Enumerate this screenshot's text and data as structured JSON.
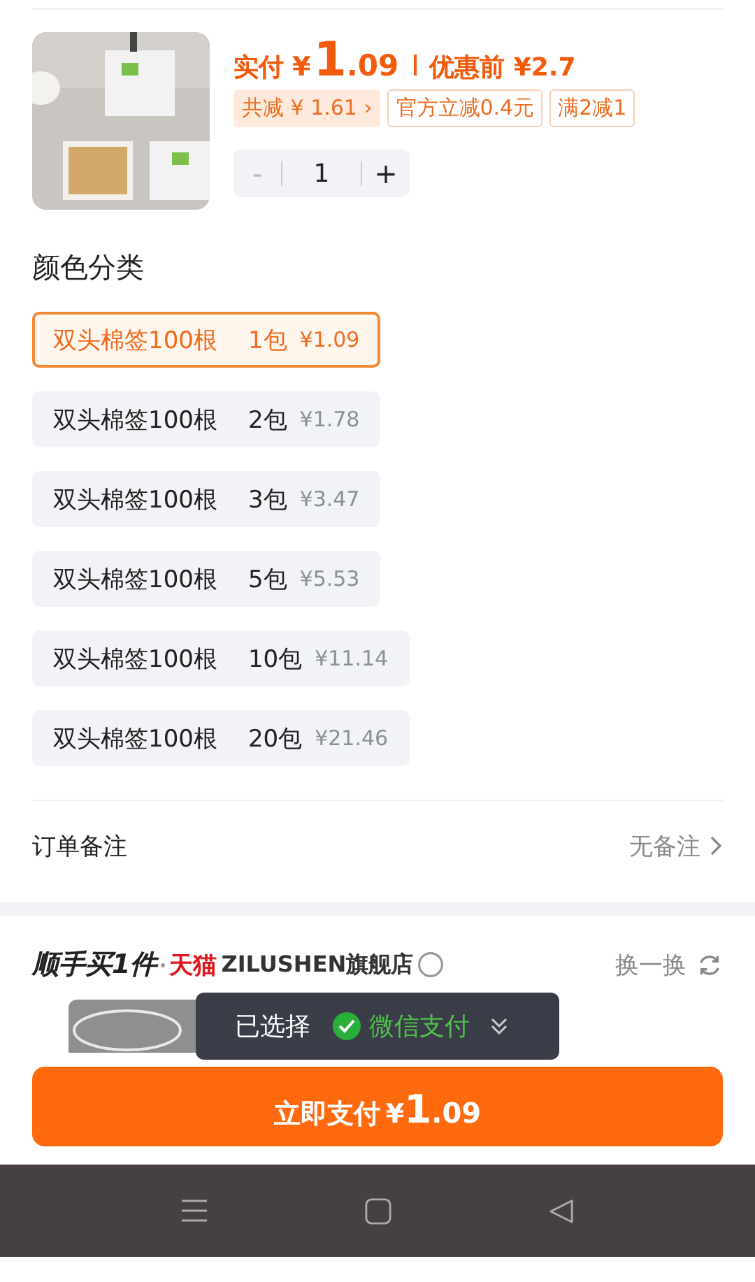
{
  "product": {
    "price_label": "实付",
    "price_currency": "¥",
    "price_int": "1",
    "price_dec": ".09",
    "original_price": "优惠前 ¥2.7",
    "discounts": [
      {
        "kind": "total",
        "text": "共减 ¥ 1.61 ›"
      },
      {
        "kind": "tag",
        "text": "官方立减0.4元"
      },
      {
        "kind": "tag",
        "text": "满2减1"
      }
    ],
    "quantity": {
      "minus": "-",
      "value": "1",
      "plus": "+",
      "minus_disabled": true
    }
  },
  "options_title": "颜色分类",
  "options": [
    {
      "name": "双头棉签100根",
      "count": "1包",
      "price": "¥1.09",
      "selected": true
    },
    {
      "name": "双头棉签100根",
      "count": "2包",
      "price": "¥1.78",
      "selected": false
    },
    {
      "name": "双头棉签100根",
      "count": "3包",
      "price": "¥3.47",
      "selected": false
    },
    {
      "name": "双头棉签100根",
      "count": "5包",
      "price": "¥5.53",
      "selected": false
    },
    {
      "name": "双头棉签100根",
      "count": "10包",
      "price": "¥11.14",
      "selected": false
    },
    {
      "name": "双头棉签100根",
      "count": "20包",
      "price": "¥21.46",
      "selected": false
    }
  ],
  "note": {
    "label": "订单备注",
    "value": "无备注"
  },
  "addon": {
    "title": "顺手买1件",
    "store_brand": "天猫",
    "store": "ZILUSHEN旗舰店",
    "refresh": "换一换"
  },
  "toast": {
    "label": "已选择",
    "method": "微信支付"
  },
  "pay_button": {
    "label": "立即支付",
    "currency": "¥",
    "int": "1",
    "dec": ".09"
  }
}
